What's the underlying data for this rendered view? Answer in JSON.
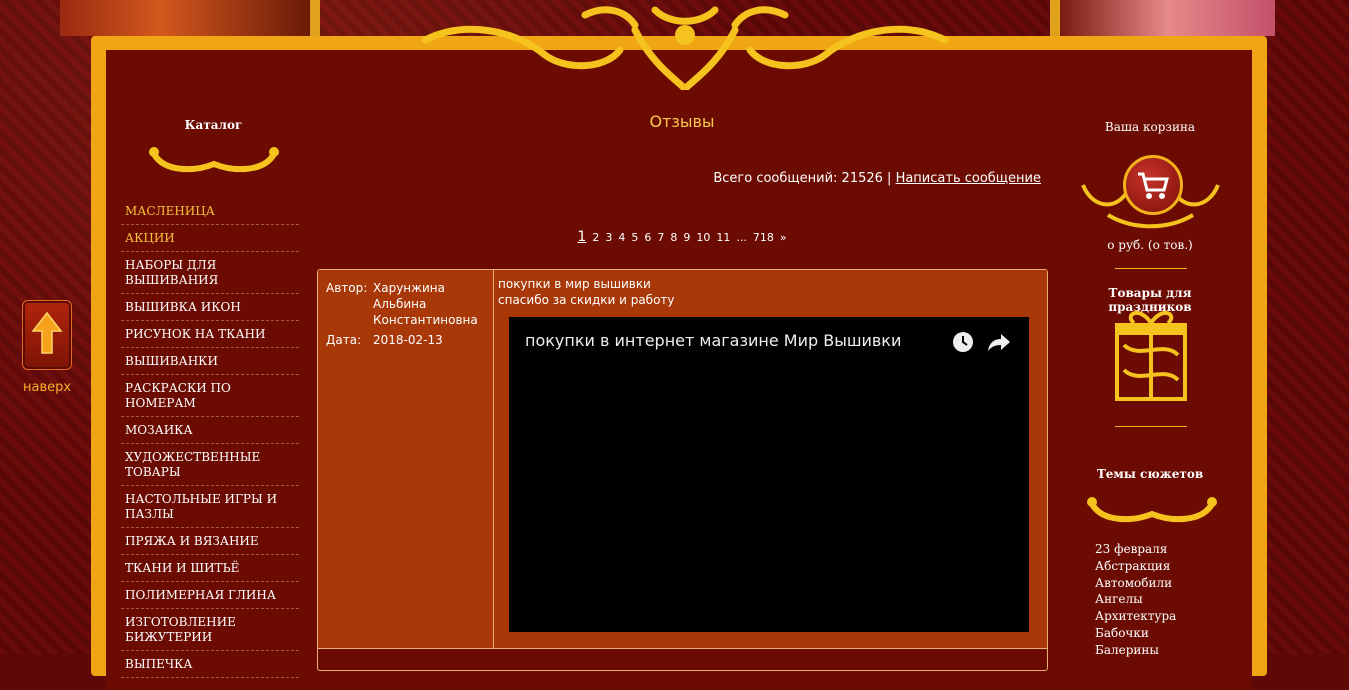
{
  "colors": {
    "accent": "#f8c94a",
    "frame": "#f0a614",
    "panel": "#6b0b02",
    "review_bg": "#a83808"
  },
  "left": {
    "title": "Каталог",
    "items": [
      {
        "label": "МАСЛЕНИЦА",
        "highlight": true
      },
      {
        "label": "АКЦИИ",
        "highlight": true
      },
      {
        "label": "НАБОРЫ ДЛЯ ВЫШИВАНИЯ"
      },
      {
        "label": "ВЫШИВКА ИКОН"
      },
      {
        "label": "РИСУНОК НА ТКАНИ"
      },
      {
        "label": "ВЫШИВАНКИ"
      },
      {
        "label": "РАСКРАСКИ ПО НОМЕРАМ"
      },
      {
        "label": "МОЗАИКА"
      },
      {
        "label": "ХУДОЖЕСТВЕННЫЕ ТОВАРЫ"
      },
      {
        "label": "НАСТОЛЬНЫЕ ИГРЫ И ПАЗЛЫ"
      },
      {
        "label": "ПРЯЖА И ВЯЗАНИЕ"
      },
      {
        "label": "ТКАНИ И ШИТЬЁ"
      },
      {
        "label": "ПОЛИМЕРНАЯ ГЛИНА"
      },
      {
        "label": "ИЗГОТОВЛЕНИЕ БИЖУТЕРИИ"
      },
      {
        "label": "ВЫПЕЧКА"
      }
    ]
  },
  "scroll_up": {
    "label": "наверх",
    "icon": "arrow-up-icon"
  },
  "main": {
    "title": "Отзывы",
    "total_prefix": "Всего сообщений: 21526 |",
    "write_link": "Написать сообщение",
    "pages": [
      "1",
      "2",
      "3",
      "4",
      "5",
      "6",
      "7",
      "8",
      "9",
      "10",
      "11",
      "...",
      "718",
      "»"
    ],
    "current_page": "1",
    "review": {
      "author_label": "Автор:",
      "author": "Харунжина Альбина Константиновна",
      "date_label": "Дата:",
      "date": "2018-02-13",
      "line1": "покупки в мир вышивки",
      "line2": "спасибо за скидки и работу",
      "video_title": "покупки в интернет магазине Мир Вышивки"
    }
  },
  "right": {
    "cart_title": "Ваша корзина",
    "cart_info": "о руб.   (о тов.)",
    "holidays_title": "Товары для праздников",
    "themes_title": "Темы сюжетов",
    "themes": [
      "23 февраля",
      "Абстракция",
      "Автомобили",
      "Ангелы",
      "Архитектура",
      "Бабочки",
      "Балерины"
    ]
  }
}
